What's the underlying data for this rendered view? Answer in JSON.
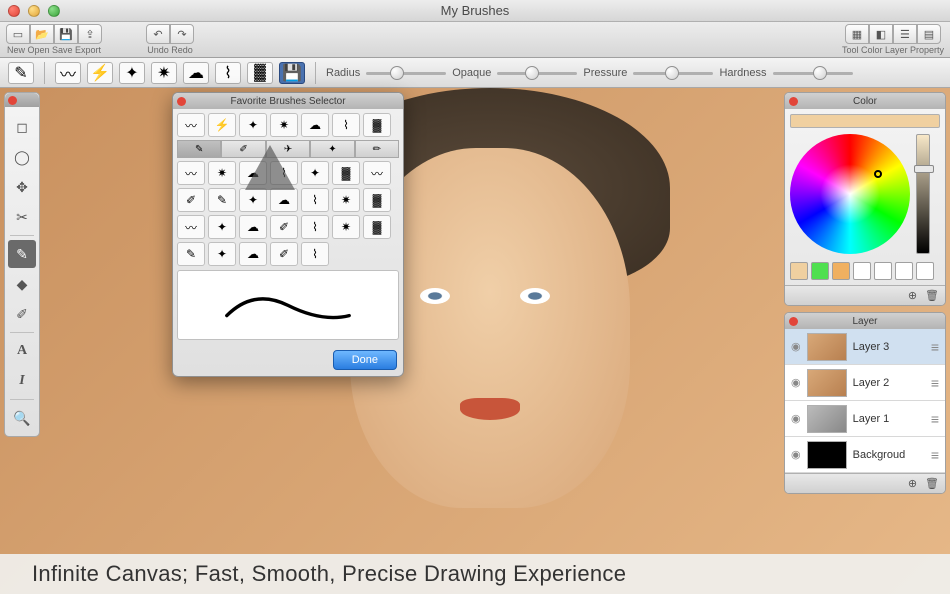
{
  "window": {
    "title": "My Brushes"
  },
  "toolbar": {
    "left_groups": [
      {
        "label": "New Open Save Export",
        "icons": [
          "document-new-icon",
          "folder-open-icon",
          "save-icon",
          "export-icon"
        ]
      },
      {
        "label": "Undo Redo",
        "icons": [
          "undo-icon",
          "redo-icon"
        ]
      }
    ],
    "right_group": {
      "label": "Tool Color Layer Property",
      "icons": [
        "tool-panel-icon",
        "color-panel-icon",
        "layer-panel-icon",
        "property-panel-icon"
      ]
    }
  },
  "brushbar": {
    "sliders": [
      {
        "label": "Radius",
        "value": 30
      },
      {
        "label": "Opaque",
        "value": 35
      },
      {
        "label": "Pressure",
        "value": 40
      },
      {
        "label": "Hardness",
        "value": 50
      }
    ]
  },
  "left_tools": [
    "marquee",
    "lasso",
    "move",
    "crop",
    "brush",
    "eraser",
    "eyedropper",
    "text-a",
    "text-i",
    "zoom"
  ],
  "color_panel": {
    "title": "Color",
    "current": "#f0d0a0",
    "swatches": [
      "#f0d0a0",
      "#50e050",
      "#f0b060",
      "#ffffff",
      "#ffffff",
      "#ffffff",
      "#ffffff"
    ]
  },
  "layer_panel": {
    "title": "Layer",
    "layers": [
      {
        "name": "Layer 3",
        "visible": true,
        "selected": true,
        "thumb": "color"
      },
      {
        "name": "Layer 2",
        "visible": true,
        "selected": false,
        "thumb": "color"
      },
      {
        "name": "Layer 1",
        "visible": true,
        "selected": false,
        "thumb": "gray"
      },
      {
        "name": "Backgroud",
        "visible": true,
        "selected": false,
        "thumb": "bg"
      }
    ]
  },
  "popup": {
    "title": "Favorite Brushes Selector",
    "done": "Done"
  },
  "caption": "Infinite Canvas; Fast, Smooth, Precise Drawing Experience"
}
